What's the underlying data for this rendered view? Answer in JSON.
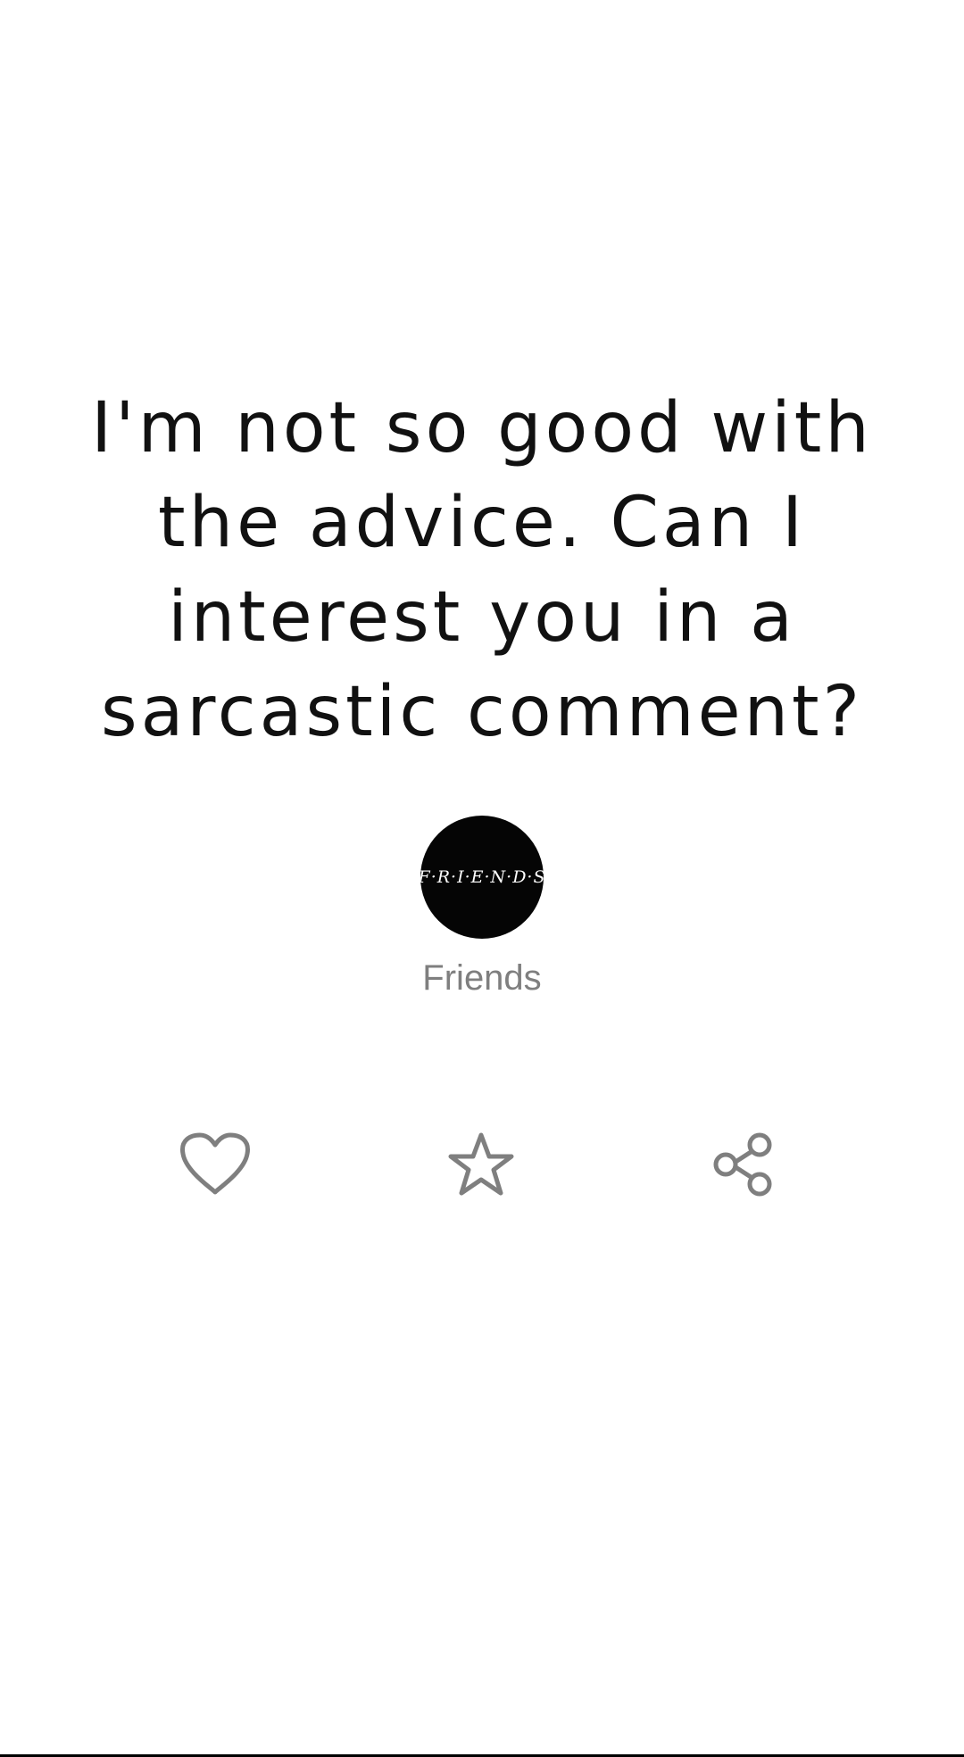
{
  "quote": {
    "lines": [
      "I'm not so good with",
      "the advice. Can I",
      "interest you in a",
      "sarcastic comment?"
    ]
  },
  "author": {
    "name": "Friends",
    "avatar_logo_text": "F·R·I·E·N·D·S"
  },
  "actions": {
    "like_icon": "heart-icon",
    "favorite_icon": "star-icon",
    "share_icon": "share-icon",
    "icon_color": "#7f7f7f"
  },
  "colors": {
    "background": "#ffffff",
    "quote_text": "#111111",
    "author_text": "#7f7f7f",
    "avatar_background": "#050505"
  }
}
